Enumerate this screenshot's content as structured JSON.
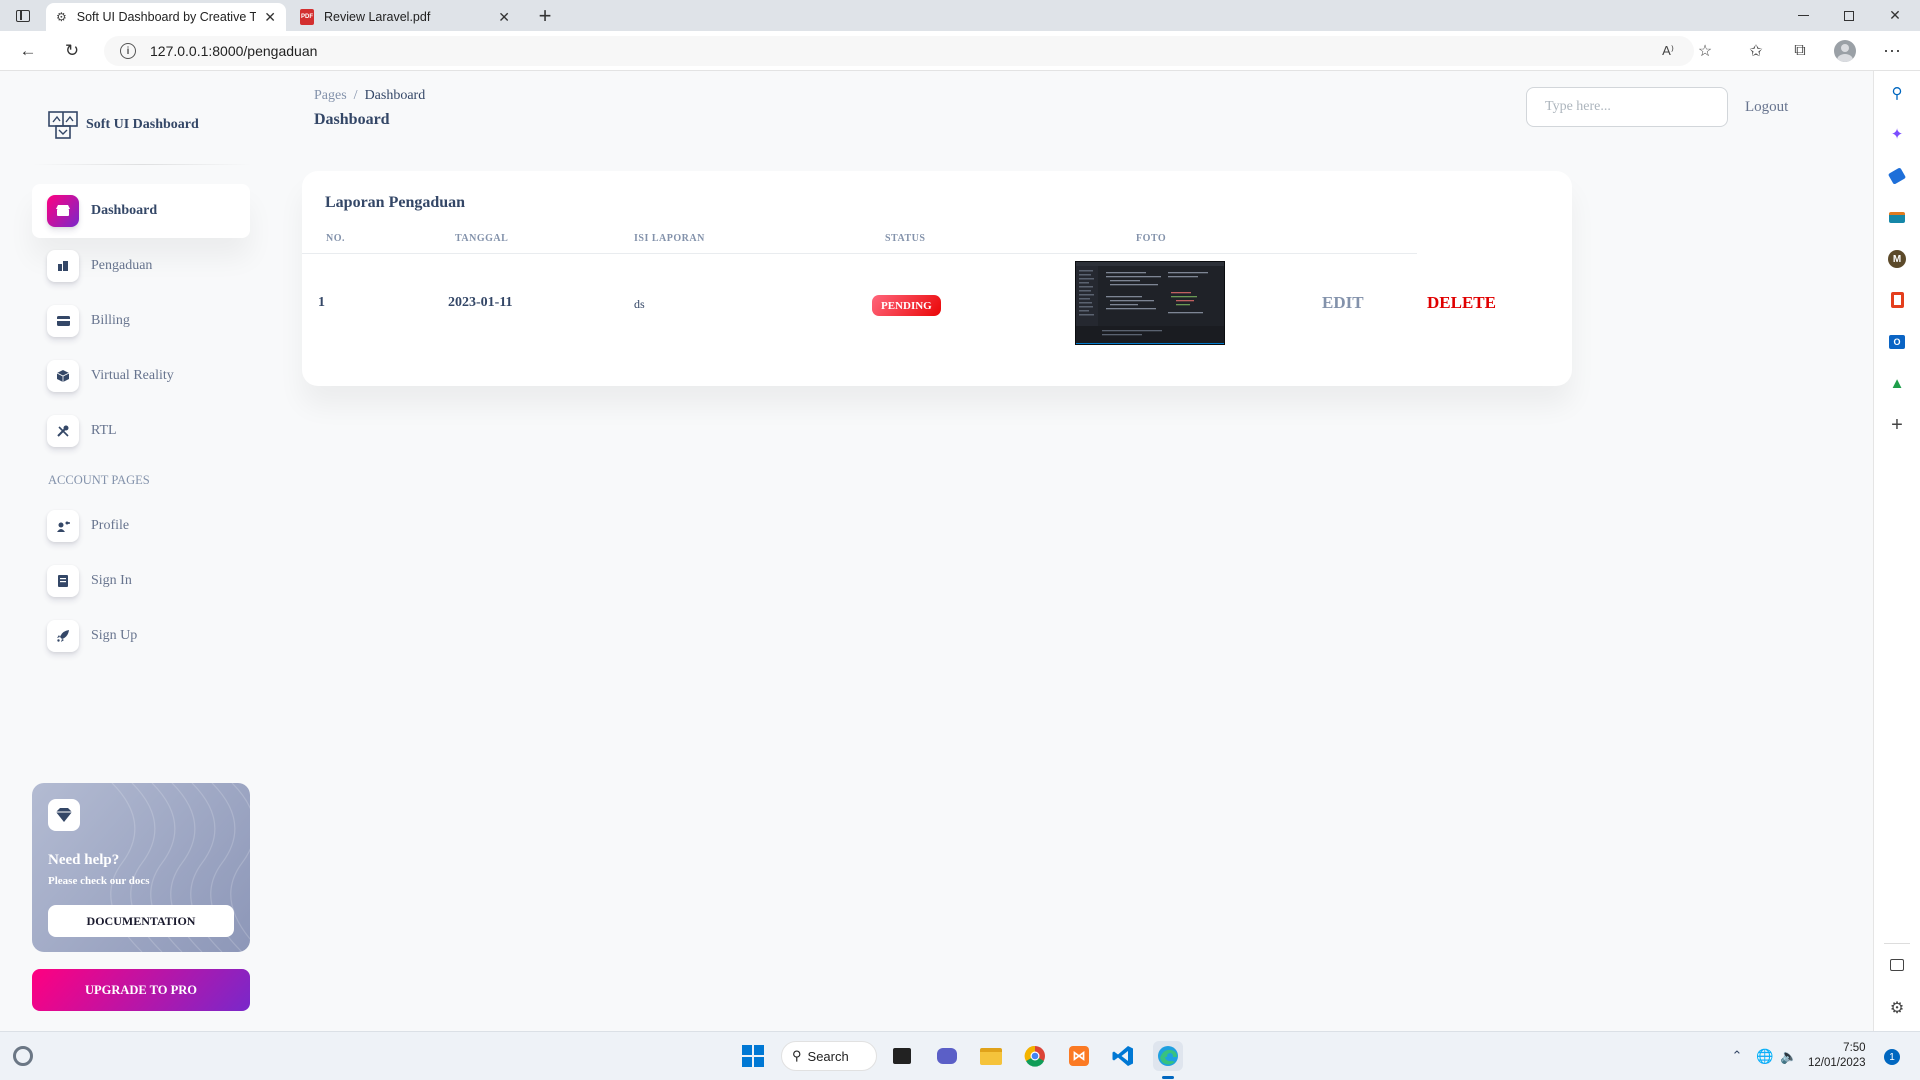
{
  "browser": {
    "tabs": [
      {
        "title": "Soft UI Dashboard by Creative Ti",
        "active": true
      },
      {
        "title": "Review Laravel.pdf",
        "active": false
      }
    ],
    "url": "127.0.0.1:8000/pengaduan",
    "read_aloud_label": "A⁾"
  },
  "sidebar": {
    "brand": "Soft UI Dashboard",
    "items": [
      {
        "label": "Dashboard",
        "icon": "shop-icon",
        "active": true
      },
      {
        "label": "Pengaduan",
        "icon": "office-icon",
        "active": false
      },
      {
        "label": "Billing",
        "icon": "credit-card-icon",
        "active": false
      },
      {
        "label": "Virtual Reality",
        "icon": "box-3d-icon",
        "active": false
      },
      {
        "label": "RTL",
        "icon": "settings-icon",
        "active": false
      }
    ],
    "section_heading": "ACCOUNT PAGES",
    "account_items": [
      {
        "label": "Profile",
        "icon": "customer-support-icon"
      },
      {
        "label": "Sign In",
        "icon": "document-icon"
      },
      {
        "label": "Sign Up",
        "icon": "spaceship-icon"
      }
    ],
    "help_card": {
      "title": "Need help?",
      "subtitle": "Please check our docs",
      "button": "DOCUMENTATION"
    },
    "upgrade_button": "UPGRADE TO PRO"
  },
  "navbar": {
    "breadcrumb": {
      "root": "Pages",
      "separator": "/",
      "current": "Dashboard"
    },
    "title": "Dashboard",
    "search_placeholder": "Type here...",
    "logout": "Logout"
  },
  "report": {
    "title": "Laporan Pengaduan",
    "columns": [
      "NO.",
      "TANGGAL",
      "ISI LAPORAN",
      "STATUS",
      "FOTO"
    ],
    "rows": [
      {
        "no": "1",
        "tanggal": "2023-01-11",
        "isi": "ds",
        "status": "PENDING",
        "edit": "EDIT",
        "delete": "DELETE"
      }
    ]
  },
  "taskbar": {
    "search_label": "Search",
    "time": "7:50",
    "date": "12/01/2023",
    "notification_count": "1"
  },
  "colors": {
    "accent_gradient_start": "#7928ca",
    "accent_gradient_end": "#ff0080",
    "status_pending": "#ea0606",
    "delete_red": "#e00000",
    "text_primary": "#344767",
    "text_secondary": "#67748e"
  }
}
